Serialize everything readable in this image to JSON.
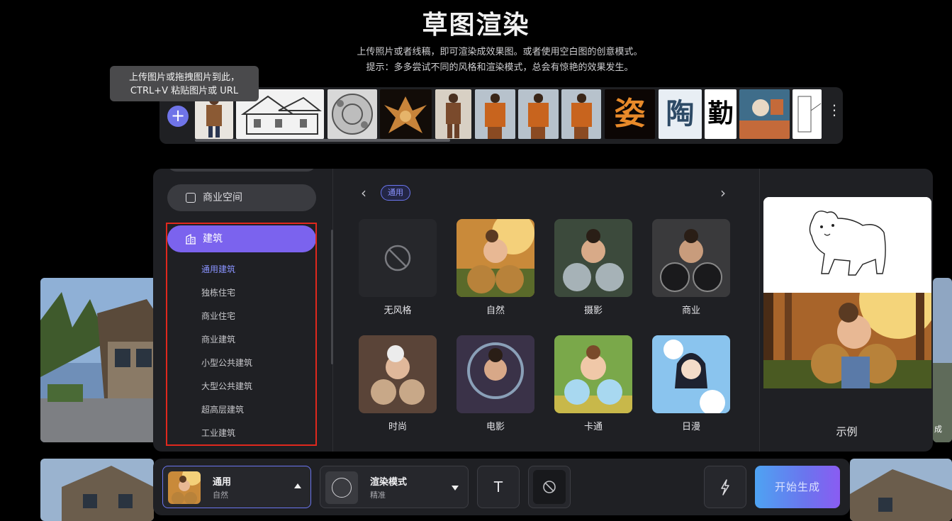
{
  "header": {
    "title": "草图渲染",
    "subtitle": "上传照片或者线稿，即可渲染成效果图。或者使用空白图的创意模式。",
    "hint": "提示：多多尝试不同的风格和渲染模式，总会有惊艳的效果发生。"
  },
  "upload_tooltip": {
    "line1": "上传图片或拖拽图片到此，",
    "line2": "CTRL+V 粘贴图片或 URL"
  },
  "thumbnail_strip": {
    "add_label": "+",
    "more_label": "⋮",
    "thumbs": [
      "fashion-person",
      "house-sketch",
      "dish-sketch",
      "gold-dragon",
      "fashion-person",
      "fashion-person",
      "fashion-person",
      "fashion-person",
      "fire-calligraphy",
      "ice-calligraphy",
      "ink-calligraphy",
      "interior-room",
      "line-interior"
    ],
    "calligraphy": {
      "t1": "姿",
      "t2": "陶",
      "t3": "勤"
    }
  },
  "sidebar": {
    "category": "商业空间",
    "active": "建筑",
    "items": [
      "通用建筑",
      "独栋住宅",
      "商业住宅",
      "商业建筑",
      "小型公共建筑",
      "大型公共建筑",
      "超高层建筑",
      "工业建筑"
    ],
    "selected_index": 0
  },
  "style_grid": {
    "chip": "通用",
    "prev": "‹",
    "next": "›",
    "styles": [
      {
        "label": "无风格"
      },
      {
        "label": "自然"
      },
      {
        "label": "摄影"
      },
      {
        "label": "商业"
      },
      {
        "label": "时尚"
      },
      {
        "label": "电影"
      },
      {
        "label": "卡通"
      },
      {
        "label": "日漫"
      }
    ]
  },
  "example": {
    "label": "示例"
  },
  "background": {
    "edge_label": "成"
  },
  "toolbar": {
    "style_name": "通用",
    "style_sub": "自然",
    "mode_name": "渲染模式",
    "mode_sub": "精准",
    "text_icon": "T",
    "generate_label": "开始生成"
  },
  "colors": {
    "accent": "#7b63ee",
    "chip": "#6b76f0",
    "highlight_box": "#e0281d"
  }
}
